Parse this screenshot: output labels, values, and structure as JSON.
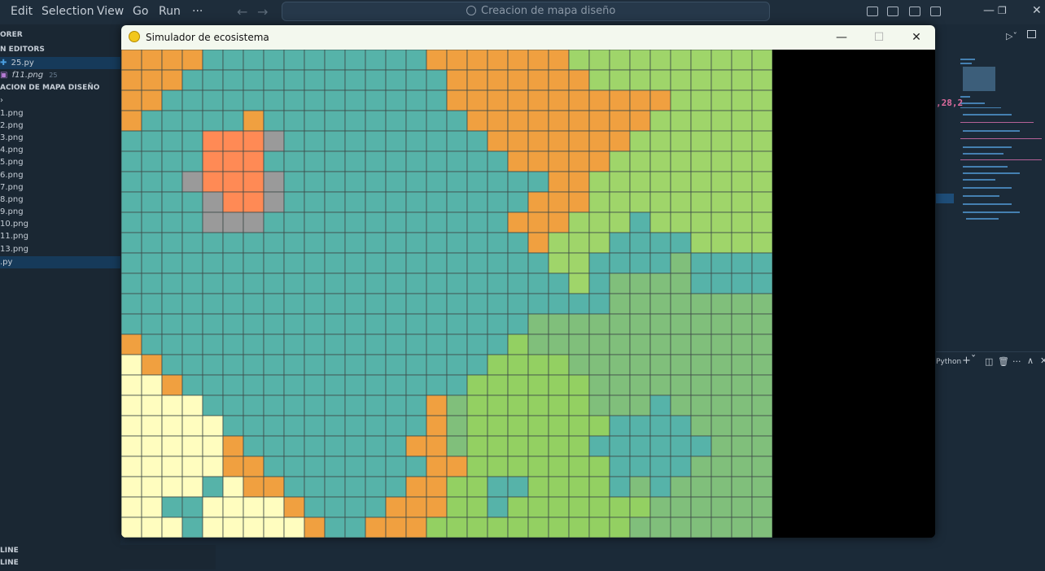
{
  "vscode": {
    "menu": [
      "Edit",
      "Selection",
      "View",
      "Go",
      "Run",
      "···"
    ],
    "search_text": "Creacion de mapa diseño",
    "sidebar": {
      "explorer": "ORER",
      "open_editors": "N EDITORS",
      "open_files": [
        {
          "name": "25.py",
          "badge": "",
          "selected": true
        },
        {
          "name": "f11.png",
          "badge": "25",
          "selected": false
        }
      ],
      "folder": "ACION DE MAPA DISEÑO",
      "files": [
        "1.png",
        "2.png",
        "3.png",
        "4.png",
        "5.png",
        "6.png",
        "7.png",
        "8.png",
        "9.png",
        "10.png",
        "11.png",
        "13.png",
        ".py"
      ],
      "bottom": [
        "LINE",
        "LINE"
      ]
    },
    "code_overlay": ",28,2",
    "panel_label": "Python"
  },
  "window": {
    "title": "Simulador de ecosistema",
    "min_symbol": "—",
    "max_symbol": "☐",
    "close_symbol": "✕"
  },
  "colors": {
    "A": "#56b3a9",
    "O": "#f0a040",
    "R": "#ff8a55",
    "G": "#9a9a9a",
    "L": "#9fd56a",
    "M": "#80bf7b",
    "D": "#93d062",
    "Y": "#fffdbf",
    "grid_line": "#3d4a48"
  },
  "map": [
    "OOOOAAAAAAAAAAAOOOOOOOLLLLLLLLLL",
    "OOOAAAAAAAAAAAAAOOOOOOOLLLLLLLLL",
    "OOAAAAAAAAAAAAAAOOOOOOOOOOOLLLLL",
    "OAAAAAOAAAAAAAAAAOOOOOOOOOLLLLLL",
    "AAAARRRGAAAAAAAAAAOOOOOOOLLLLLLL",
    "AAAARRRAAAAAAAAAAAAOOOOOLLLLLLLL",
    "AAAGRRRGAAAAAAAAAAAAAOOLLLLLLLLL",
    "AAAAGRRGAAAAAAAAAAAAOOOLLLLLLLLL",
    "AAAAGGGAAAAAAAAAAAAOOOLLLALLLLLL",
    "AAAAAAAAAAAAAAAAAAAAOLLLAAAALLLL",
    "AAAAAAAAAAAAAAAAAAAAALLAAAAMAAAA",
    "AAAAAAAAAAAAAAAAAAAAAALAMMMMAAAA",
    "AAAAAAAAAAAAAAAAAAAAAAAAMMMMMMMM",
    "AAAAAAAAAAAAAAAAAAAAMMMMMMMMMMMM",
    "OAAAAAAAAAAAAAAAAAADMMMMMMMMMMMM",
    "YOAAAAAAAAAAAAAAAADDDDMMMMMMMMMM",
    "YYOAAAAAAAAAAAAAADDDDDDMMMMMMMMM",
    "YYYYAAAAAAAAAAAOMDDDDDDMMMAMMMMM",
    "YYYYYAAAAAAAAAAOMDDDDDDDAAAAMMMM",
    "YYYYYOAAAAAAAAOOMDDDDDDAAAAAAMMM",
    "YYYYYOOAAAAAAAAOODDDDDDDAAAAMMMM",
    "YYYYAYOOAAAAAAOODDAADDDDAMAMMMMM",
    "YYAAYYYYOAAAAOOODDADDDDDDDMMMMMM",
    "YYYAYYYYYOAAOOODDDDDDDDDDMMMMMMM"
  ]
}
